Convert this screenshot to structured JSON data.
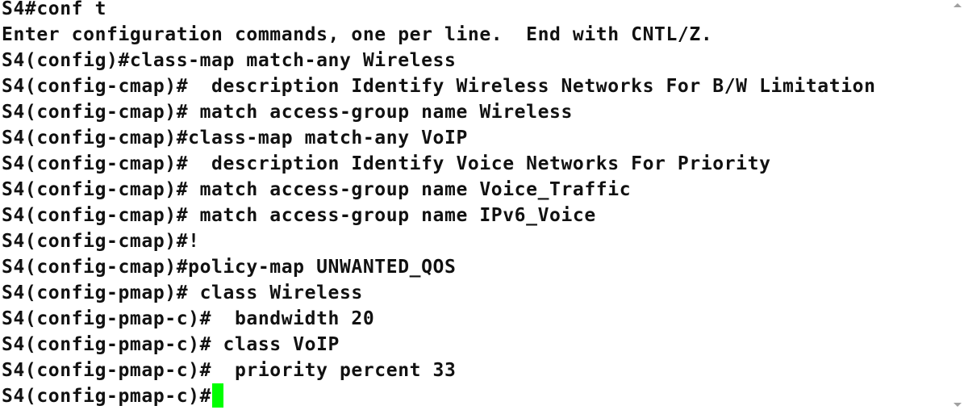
{
  "terminal": {
    "lines": [
      "S4#conf t",
      "Enter configuration commands, one per line.  End with CNTL/Z.",
      "S4(config)#class-map match-any Wireless",
      "S4(config-cmap)#  description Identify Wireless Networks For B/W Limitation",
      "S4(config-cmap)# match access-group name Wireless",
      "S4(config-cmap)#class-map match-any VoIP",
      "S4(config-cmap)#  description Identify Voice Networks For Priority",
      "S4(config-cmap)# match access-group name Voice_Traffic",
      "S4(config-cmap)# match access-group name IPv6_Voice",
      "S4(config-cmap)#!",
      "S4(config-cmap)#policy-map UNWANTED_QOS",
      "S4(config-pmap)# class Wireless",
      "S4(config-pmap-c)#  bandwidth 20",
      "S4(config-pmap-c)# class VoIP",
      "S4(config-pmap-c)#  priority percent 33"
    ],
    "prompt": "S4(config-pmap-c)#",
    "cursor_color": "#00ff00",
    "background_color": "#ffffff",
    "text_color": "#111111"
  },
  "scrollbar": {
    "up_icon": "triangle-up-icon",
    "down_icon": "triangle-down-icon"
  }
}
